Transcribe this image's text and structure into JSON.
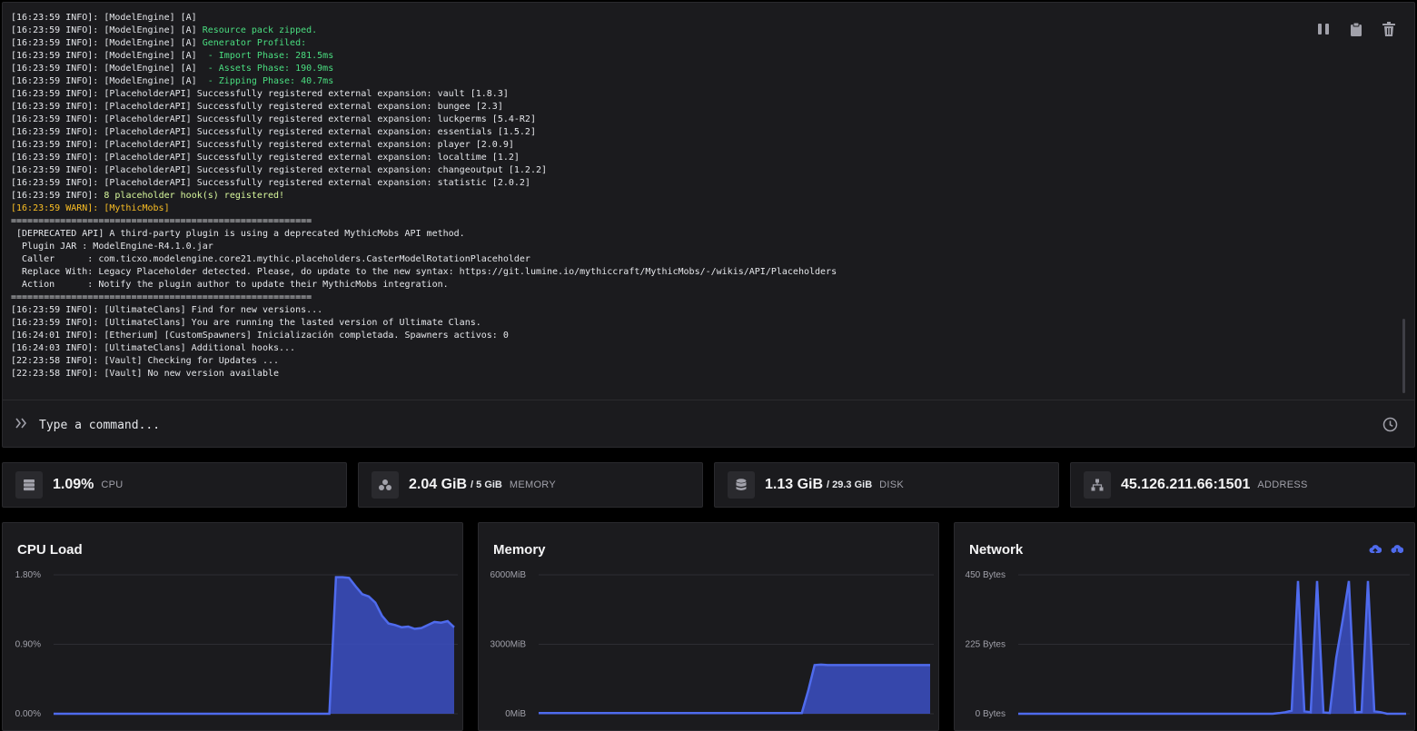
{
  "console": {
    "lines": [
      {
        "parts": [
          {
            "t": "[16:23:59 INFO]: [ModelEngine] [A]",
            "c": "c-info"
          }
        ]
      },
      {
        "parts": [
          {
            "t": "[16:23:59 INFO]: [ModelEngine] [A] ",
            "c": "c-info"
          },
          {
            "t": "Resource pack zipped.",
            "c": "c-green"
          }
        ]
      },
      {
        "parts": [
          {
            "t": "[16:23:59 INFO]: [ModelEngine] [A] ",
            "c": "c-info"
          },
          {
            "t": "Generator Profiled:",
            "c": "c-green"
          }
        ]
      },
      {
        "parts": [
          {
            "t": "[16:23:59 INFO]: [ModelEngine] [A]  ",
            "c": "c-info"
          },
          {
            "t": "- Import Phase: 281.5ms",
            "c": "c-green"
          }
        ]
      },
      {
        "parts": [
          {
            "t": "[16:23:59 INFO]: [ModelEngine] [A]  ",
            "c": "c-info"
          },
          {
            "t": "- Assets Phase: 190.9ms",
            "c": "c-green"
          }
        ]
      },
      {
        "parts": [
          {
            "t": "[16:23:59 INFO]: [ModelEngine] [A]  ",
            "c": "c-info"
          },
          {
            "t": "- Zipping Phase: 40.7ms",
            "c": "c-green"
          }
        ]
      },
      {
        "parts": [
          {
            "t": "[16:23:59 INFO]: [PlaceholderAPI] Successfully registered external expansion: vault [1.8.3]",
            "c": "c-info"
          }
        ]
      },
      {
        "parts": [
          {
            "t": "[16:23:59 INFO]: [PlaceholderAPI] Successfully registered external expansion: bungee [2.3]",
            "c": "c-info"
          }
        ]
      },
      {
        "parts": [
          {
            "t": "[16:23:59 INFO]: [PlaceholderAPI] Successfully registered external expansion: luckperms [5.4-R2]",
            "c": "c-info"
          }
        ]
      },
      {
        "parts": [
          {
            "t": "[16:23:59 INFO]: [PlaceholderAPI] Successfully registered external expansion: essentials [1.5.2]",
            "c": "c-info"
          }
        ]
      },
      {
        "parts": [
          {
            "t": "[16:23:59 INFO]: [PlaceholderAPI] Successfully registered external expansion: player [2.0.9]",
            "c": "c-info"
          }
        ]
      },
      {
        "parts": [
          {
            "t": "[16:23:59 INFO]: [PlaceholderAPI] Successfully registered external expansion: localtime [1.2]",
            "c": "c-info"
          }
        ]
      },
      {
        "parts": [
          {
            "t": "[16:23:59 INFO]: [PlaceholderAPI] Successfully registered external expansion: changeoutput [1.2.2]",
            "c": "c-info"
          }
        ]
      },
      {
        "parts": [
          {
            "t": "[16:23:59 INFO]: [PlaceholderAPI] Successfully registered external expansion: statistic [2.0.2]",
            "c": "c-info"
          }
        ]
      },
      {
        "parts": [
          {
            "t": "[16:23:59 INFO]: ",
            "c": "c-info"
          },
          {
            "t": "8 placeholder hook(s) registered!",
            "c": "c-yellow"
          }
        ]
      },
      {
        "parts": [
          {
            "t": "[16:23:59 WARN]: [MythicMobs]",
            "c": "c-warn"
          }
        ]
      },
      {
        "parts": [
          {
            "t": "=======================================================",
            "c": "c-info"
          }
        ]
      },
      {
        "parts": [
          {
            "t": " [DEPRECATED API] A third-party plugin is using a deprecated MythicMobs API method.",
            "c": "c-info"
          }
        ]
      },
      {
        "parts": [
          {
            "t": "  Plugin JAR : ModelEngine-R4.1.0.jar",
            "c": "c-info"
          }
        ]
      },
      {
        "parts": [
          {
            "t": "  Caller      : com.ticxo.modelengine.core21.mythic.placeholders.CasterModelRotationPlaceholder",
            "c": "c-info"
          }
        ]
      },
      {
        "parts": [
          {
            "t": "  Replace With: Legacy Placeholder detected. Please, do update to the new syntax: https://git.lumine.io/mythiccraft/MythicMobs/-/wikis/API/Placeholders",
            "c": "c-info"
          }
        ]
      },
      {
        "parts": [
          {
            "t": "  Action      : Notify the plugin author to update their MythicMobs integration.",
            "c": "c-info"
          }
        ]
      },
      {
        "parts": [
          {
            "t": "=======================================================",
            "c": "c-info"
          }
        ]
      },
      {
        "parts": [
          {
            "t": "[16:23:59 INFO]: [UltimateClans] Find for new versions...",
            "c": "c-info"
          }
        ]
      },
      {
        "parts": [
          {
            "t": "[16:23:59 INFO]: [UltimateClans] You are running the lasted version of Ultimate Clans.",
            "c": "c-info"
          }
        ]
      },
      {
        "parts": [
          {
            "t": "[16:24:01 INFO]: [Etherium] [CustomSpawners] Inicialización completada. Spawners activos: 0",
            "c": "c-info"
          }
        ]
      },
      {
        "parts": [
          {
            "t": "[16:24:03 INFO]: [UltimateClans] Additional hooks...",
            "c": "c-info"
          }
        ]
      },
      {
        "parts": [
          {
            "t": "[22:23:58 INFO]: [Vault] Checking for Updates ...",
            "c": "c-info"
          }
        ]
      },
      {
        "parts": [
          {
            "t": "[22:23:58 INFO]: [Vault] No new version available",
            "c": "c-info"
          }
        ]
      }
    ],
    "tools": [
      {
        "name": "pause-icon"
      },
      {
        "name": "clipboard-icon"
      },
      {
        "name": "trash-icon"
      }
    ],
    "command_placeholder": "Type a command..."
  },
  "stats": [
    {
      "icon": "server-icon",
      "value": "1.09%",
      "sub": "",
      "label": "CPU"
    },
    {
      "icon": "memory-icon",
      "value": "2.04 GiB",
      "sub": "/ 5 GiB",
      "label": "MEMORY"
    },
    {
      "icon": "database-icon",
      "value": "1.13 GiB",
      "sub": "/ 29.3 GiB",
      "label": "DISK"
    },
    {
      "icon": "network-icon",
      "value": "45.126.211.66:1501",
      "sub": "",
      "label": "ADDRESS"
    }
  ],
  "colors": {
    "accent": "#4f6bed",
    "fill": "#3b4fc4",
    "panel": "#1b1b1e"
  },
  "chart_data": [
    {
      "type": "area",
      "title": "CPU Load",
      "yticks": [
        "1.80%",
        "0.90%",
        "0.00%"
      ],
      "ylim": [
        0,
        1.8
      ],
      "y": [
        0,
        0,
        0,
        0,
        0,
        0,
        0,
        0,
        0,
        0,
        0,
        0,
        0,
        0,
        0,
        0,
        0,
        0,
        0,
        0,
        0,
        0,
        0,
        0,
        0,
        0,
        0,
        0,
        0,
        0,
        0,
        0,
        0,
        0,
        0,
        0,
        0,
        0,
        0,
        0,
        0,
        0,
        0,
        1.77,
        1.77,
        1.76,
        1.65,
        1.55,
        1.52,
        1.44,
        1.27,
        1.17,
        1.15,
        1.12,
        1.13,
        1.1,
        1.11,
        1.15,
        1.19,
        1.18,
        1.2,
        1.12
      ]
    },
    {
      "type": "area",
      "title": "Memory",
      "yticks": [
        "6000MiB",
        "3000MiB",
        "0MiB"
      ],
      "ylim": [
        0,
        6000
      ],
      "y": [
        30,
        30,
        30,
        30,
        30,
        30,
        30,
        30,
        30,
        30,
        30,
        30,
        30,
        30,
        30,
        30,
        30,
        30,
        30,
        30,
        30,
        30,
        30,
        30,
        30,
        30,
        30,
        30,
        30,
        30,
        30,
        30,
        30,
        30,
        30,
        30,
        30,
        30,
        30,
        30,
        30,
        30,
        1000,
        2100,
        2120,
        2100,
        2100,
        2100,
        2100,
        2100,
        2100,
        2100,
        2100,
        2100,
        2100,
        2100,
        2100,
        2100,
        2100,
        2100,
        2100,
        2100
      ]
    },
    {
      "type": "area",
      "title": "Network",
      "yticks": [
        "450 Bytes",
        "225 Bytes",
        "0 Bytes"
      ],
      "ylim": [
        0,
        450
      ],
      "series": [
        {
          "y": [
            0,
            0,
            0,
            0,
            0,
            0,
            0,
            0,
            0,
            0,
            0,
            0,
            0,
            0,
            0,
            0,
            0,
            0,
            0,
            0,
            0,
            0,
            0,
            0,
            0,
            0,
            0,
            0,
            0,
            0,
            0,
            0,
            0,
            0,
            0,
            0,
            0,
            0,
            0,
            0,
            0,
            2,
            5,
            10,
            430,
            8,
            5,
            430,
            4,
            3,
            180,
            300,
            430,
            5,
            6,
            430,
            8,
            5,
            0,
            0,
            0,
            0
          ]
        }
      ]
    }
  ]
}
